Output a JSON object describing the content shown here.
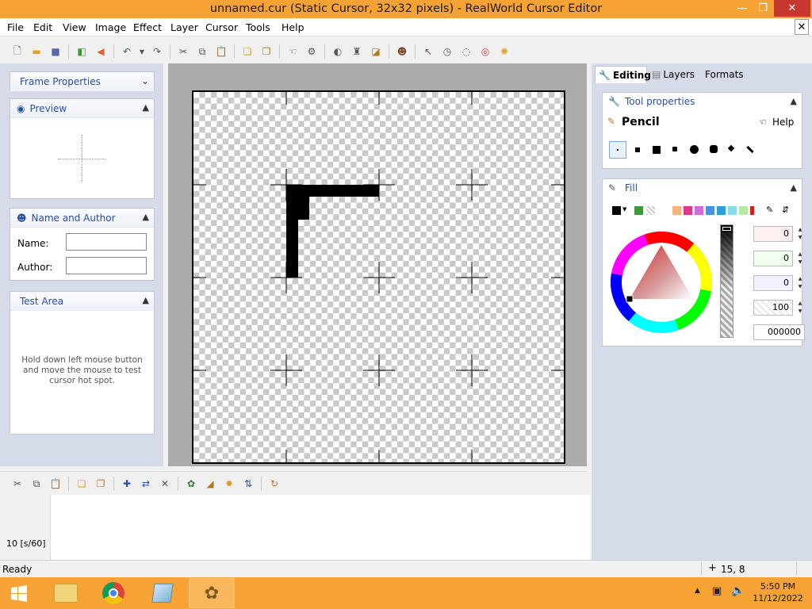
{
  "window": {
    "title": "unnamed.cur (Static Cursor, 32x32 pixels) - RealWorld Cursor Editor"
  },
  "menu": [
    "File",
    "Edit",
    "View",
    "Image",
    "Effect",
    "Layer",
    "Cursor",
    "Tools",
    "Help"
  ],
  "left": {
    "frame_properties": "Frame Properties",
    "preview": "Preview",
    "name_author": "Name and Author",
    "name_label": "Name:",
    "author_label": "Author:",
    "test_area": "Test Area",
    "test_hint": "Hold down left mouse button and move the mouse to test cursor hot spot."
  },
  "right": {
    "tabs": [
      "Editing",
      "Layers",
      "Formats"
    ],
    "tool_properties": "Tool properties",
    "tool_name": "Pencil",
    "help": "Help",
    "fill": "Fill",
    "values": [
      "0",
      "0",
      "0",
      "100"
    ],
    "hex": "000000"
  },
  "frames": {
    "cell_label": "10 [s/60]"
  },
  "status": {
    "text": "Ready",
    "coords": "15, 8"
  },
  "clock": {
    "time": "5:50 PM",
    "date": "11/12/2022"
  },
  "colors": {
    "accent": "#f6a234",
    "panel_bg": "#d6dbe9",
    "header_text": "#2a4fa0"
  }
}
